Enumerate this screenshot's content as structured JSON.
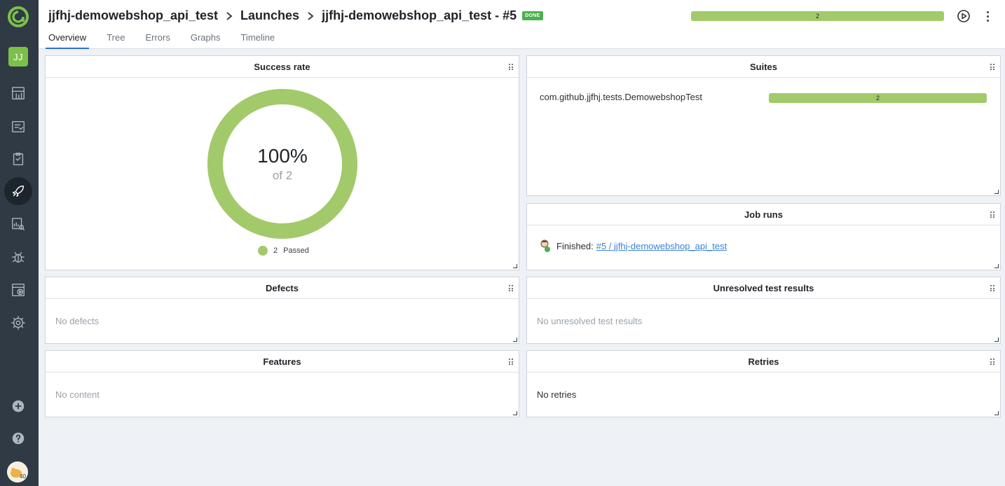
{
  "breadcrumb": {
    "project": "jjfhj-demowebshop_api_test",
    "section": "Launches",
    "launch": "jjfhj-demowebshop_api_test - #5",
    "status_badge": "DONE"
  },
  "header_bar_count": "2",
  "tabs": [
    {
      "label": "Overview",
      "active": true
    },
    {
      "label": "Tree",
      "active": false
    },
    {
      "label": "Errors",
      "active": false
    },
    {
      "label": "Graphs",
      "active": false
    },
    {
      "label": "Timeline",
      "active": false
    }
  ],
  "sidebar": {
    "project_initials": "JJ",
    "user_avatar_badge": "40",
    "icons": [
      "dashboards-icon",
      "test-cases-icon",
      "test-plans-icon",
      "launches-icon",
      "analytics-icon",
      "defects-icon",
      "jobs-icon",
      "settings-icon",
      "add-icon",
      "help-icon"
    ]
  },
  "widgets": {
    "success_rate": {
      "title": "Success rate",
      "percent": "100%",
      "of_total": "of 2",
      "legend_count": "2",
      "legend_label": "Passed",
      "passed_color": "#a2ca6a"
    },
    "suites": {
      "title": "Suites",
      "items": [
        {
          "name": "com.github.jjfhj.tests.DemowebshopTest",
          "count": "2"
        }
      ]
    },
    "job_runs": {
      "title": "Job runs",
      "status": "Finished:",
      "link": "#5 / jjfhj-demowebshop_api_test"
    },
    "defects": {
      "title": "Defects",
      "empty": "No defects"
    },
    "unresolved": {
      "title": "Unresolved test results",
      "empty": "No unresolved test results"
    },
    "features": {
      "title": "Features",
      "empty": "No content"
    },
    "retries": {
      "title": "Retries",
      "empty": "No retries"
    }
  },
  "colors": {
    "accent": "#2f6fd1",
    "passed": "#a2ca6a",
    "sidebar": "#2f3a45",
    "done": "#4caf50"
  }
}
